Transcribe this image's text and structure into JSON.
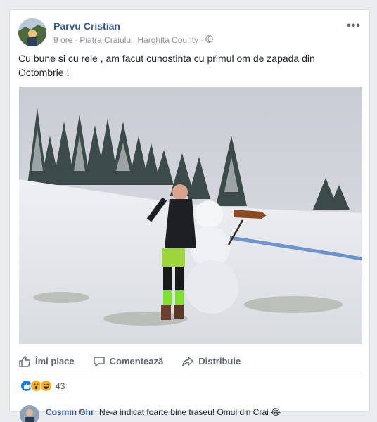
{
  "post": {
    "author": "Parvu Cristian",
    "time": "9 ore",
    "separator": "·",
    "location": "Piatra Craiului, Harghita County",
    "privacy_icon": "globe-icon",
    "text": "Cu bune si cu rele , am facut cunostinta cu primul om de zapada din Octombrie !"
  },
  "actions": {
    "like": "Îmi place",
    "comment": "Comentează",
    "share": "Distribuie"
  },
  "reactions": {
    "types": [
      "like",
      "wow",
      "haha"
    ],
    "count": "43"
  },
  "comment": {
    "name": "Cosmin Ghr",
    "text": "Ne-a indicat foarte bine traseu! Omul din Crai 😂"
  },
  "colors": {
    "link": "#365899",
    "text": "#1d2129",
    "meta": "#90949c",
    "like_blue": "#1877f2",
    "wow_yellow": "#f7b125"
  }
}
